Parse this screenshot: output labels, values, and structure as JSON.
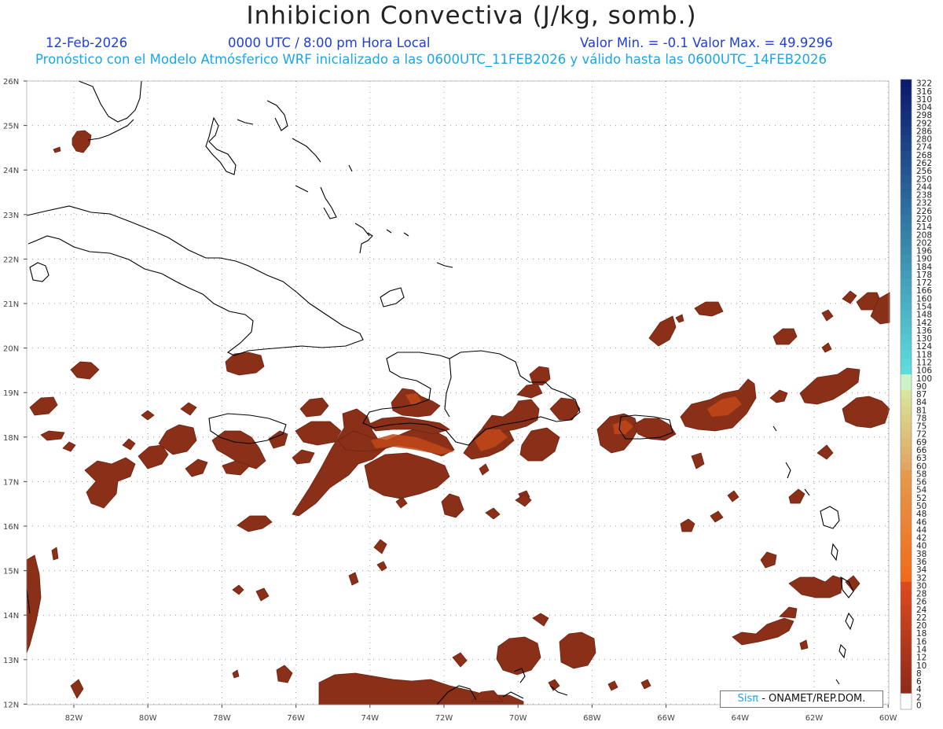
{
  "title": "Inhibicion Convectiva (J/kg, somb.)",
  "date": "12-Feb-2026",
  "time": "0000 UTC / 8:00 pm Hora Local",
  "minmax": "Valor Min. = -0.1  Valor Max. = 49.9296",
  "subtitle": "Pronóstico con el Modelo Atmósferico WRF inicializado a las 0600UTC_11FEB2026 y válido hasta las  0600UTC_14FEB2026",
  "credit": {
    "sis": "Sisπ",
    "rest": " - ONAMET/REP.DOM."
  },
  "lat_labels": [
    "26N",
    "25N",
    "24N",
    "23N",
    "22N",
    "21N",
    "20N",
    "19N",
    "18N",
    "17N",
    "16N",
    "15N",
    "14N",
    "13N",
    "12N"
  ],
  "lon_labels": [
    "82W",
    "80W",
    "78W",
    "76W",
    "74W",
    "72W",
    "70W",
    "68W",
    "66W",
    "64W",
    "62W",
    "60W"
  ],
  "colorbar_labels": [
    "322",
    "316",
    "310",
    "304",
    "298",
    "292",
    "286",
    "280",
    "274",
    "268",
    "262",
    "256",
    "250",
    "244",
    "238",
    "232",
    "226",
    "220",
    "214",
    "208",
    "202",
    "196",
    "190",
    "184",
    "178",
    "172",
    "166",
    "160",
    "154",
    "148",
    "142",
    "136",
    "130",
    "124",
    "118",
    "112",
    "106",
    "100",
    "90",
    "87",
    "84",
    "81",
    "78",
    "75",
    "72",
    "69",
    "66",
    "63",
    "60",
    "58",
    "56",
    "54",
    "52",
    "50",
    "48",
    "46",
    "44",
    "42",
    "40",
    "38",
    "36",
    "34",
    "32",
    "30",
    "28",
    "26",
    "24",
    "22",
    "20",
    "18",
    "16",
    "14",
    "12",
    "10",
    "8",
    "6",
    "4",
    "2",
    "0"
  ],
  "colors": {
    "field": "#8b3018",
    "field_edge": "#6b2212",
    "field_hot": "#c94a15"
  }
}
